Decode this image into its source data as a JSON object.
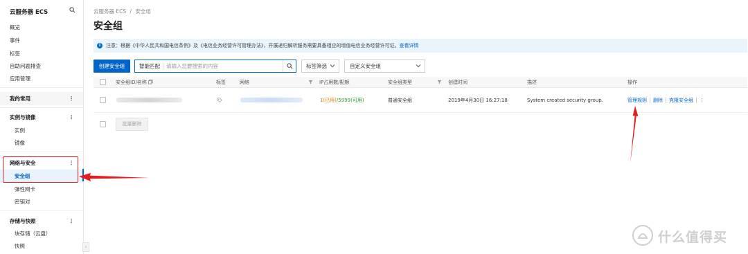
{
  "sidebar": {
    "title": "云服务器 ECS",
    "items": [
      {
        "label": "概览"
      },
      {
        "label": "事件"
      },
      {
        "label": "标签"
      },
      {
        "label": "自助问题排查"
      },
      {
        "label": "应用管理"
      }
    ],
    "mine": "我的常用",
    "group_instances": "实例与镜像",
    "instances": "实例",
    "images": "镜像",
    "group_network": "网络与安全",
    "security_groups": "安全组",
    "eni": "弹性网卡",
    "keypairs": "密钥对",
    "group_storage": "存储与快照",
    "block_storage": "块存储（云盘）",
    "snapshots": "快照",
    "dots": "⋮",
    "collapse": "‹"
  },
  "breadcrumb": {
    "root": "云服务器 ECS",
    "sep": "/",
    "current": "安全组"
  },
  "page_title": "安全组",
  "notice": {
    "icon": "i",
    "text": "注意：根据《中华人民共和国电信条例》及《电信业务经营许可管理办法》，开展递归解析服务需要具备相应的增值电信业务经营许可证。",
    "link": "查看详情"
  },
  "toolbar": {
    "create_label": "创建安全组",
    "search_type": "智能匹配",
    "search_placeholder": "请输入您要搜索的内容",
    "tag_filter": "标签筛选",
    "custom_select": "自定义安全组"
  },
  "table": {
    "headers": {
      "id_name": "安全组ID/名称",
      "tags": "标签",
      "network": "网络",
      "ip_usage": "IP占用数/配额",
      "type": "安全组类型",
      "created": "创建时间",
      "desc": "描述",
      "ops": "操作"
    },
    "rows": [
      {
        "ip_used": "1(已用)",
        "ip_avail": "/5999(可用)",
        "type": "普通安全组",
        "created": "2019年4月30日 16:27:18",
        "desc": "System created security group.",
        "op_manage": "管理规则",
        "op_delete": "删除",
        "op_clone": "克隆安全组",
        "op_more": "⋮"
      }
    ],
    "bulk_delete": "批量删除"
  },
  "watermark": "什么值得买",
  "colors": {
    "accent": "#0064c8",
    "annotation": "#e02020",
    "notice_bg": "#eaf4fd"
  }
}
